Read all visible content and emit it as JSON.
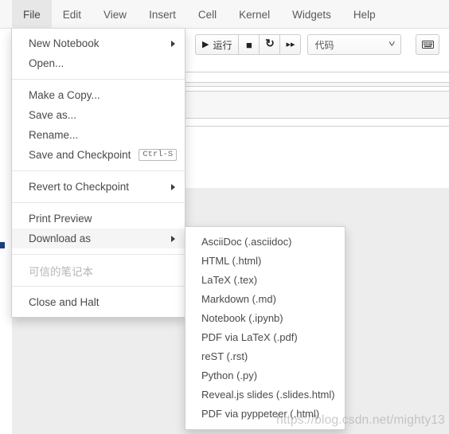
{
  "menubar": {
    "tabs": [
      {
        "label": "File",
        "active": true
      },
      {
        "label": "Edit",
        "active": false
      },
      {
        "label": "View",
        "active": false
      },
      {
        "label": "Insert",
        "active": false
      },
      {
        "label": "Cell",
        "active": false
      },
      {
        "label": "Kernel",
        "active": false
      },
      {
        "label": "Widgets",
        "active": false
      },
      {
        "label": "Help",
        "active": false
      }
    ]
  },
  "toolbar": {
    "run_label": "运行",
    "run_icon": "play-icon",
    "stop_icon": "stop-square-icon",
    "restart_icon": "restart-circle-arrow-icon",
    "fastforward_icon": "fast-forward-icon",
    "cell_type_value": "代码",
    "cell_type_caret_icon": "chevron-down-icon",
    "keyboard_icon": "keyboard-icon"
  },
  "file_menu": {
    "groups": [
      {
        "items": [
          {
            "label": "New Notebook",
            "submenu": true,
            "disabled": false,
            "hover": false,
            "shortcut": null
          },
          {
            "label": "Open...",
            "submenu": false,
            "disabled": false,
            "hover": false,
            "shortcut": null
          }
        ]
      },
      {
        "items": [
          {
            "label": "Make a Copy...",
            "submenu": false,
            "disabled": false,
            "hover": false,
            "shortcut": null
          },
          {
            "label": "Save as...",
            "submenu": false,
            "disabled": false,
            "hover": false,
            "shortcut": null
          },
          {
            "label": "Rename...",
            "submenu": false,
            "disabled": false,
            "hover": false,
            "shortcut": null
          },
          {
            "label": "Save and Checkpoint",
            "submenu": false,
            "disabled": false,
            "hover": false,
            "shortcut": "Ctrl-S"
          }
        ]
      },
      {
        "items": [
          {
            "label": "Revert to Checkpoint",
            "submenu": true,
            "disabled": false,
            "hover": false,
            "shortcut": null
          }
        ]
      },
      {
        "items": [
          {
            "label": "Print Preview",
            "submenu": false,
            "disabled": false,
            "hover": false,
            "shortcut": null
          },
          {
            "label": "Download as",
            "submenu": true,
            "disabled": false,
            "hover": true,
            "shortcut": null
          }
        ]
      },
      {
        "items": [
          {
            "label": "可信的笔记本",
            "submenu": false,
            "disabled": true,
            "hover": false,
            "shortcut": null
          }
        ]
      },
      {
        "items": [
          {
            "label": "Close and Halt",
            "submenu": false,
            "disabled": false,
            "hover": false,
            "shortcut": null
          }
        ]
      }
    ]
  },
  "download_submenu": {
    "items": [
      {
        "label": "AsciiDoc (.asciidoc)"
      },
      {
        "label": "HTML (.html)"
      },
      {
        "label": "LaTeX (.tex)"
      },
      {
        "label": "Markdown (.md)"
      },
      {
        "label": "Notebook (.ipynb)"
      },
      {
        "label": "PDF via LaTeX (.pdf)"
      },
      {
        "label": "reST (.rst)"
      },
      {
        "label": "Python (.py)"
      },
      {
        "label": "Reveal.js slides (.slides.html)"
      },
      {
        "label": "PDF via pyppeteer (.html)"
      }
    ]
  },
  "watermark": {
    "text": "https://blog.csdn.net/mighty13"
  },
  "colors": {
    "menubar_bg": "#f7f7f7",
    "active_tab_bg": "#e7e7e7",
    "menu_bg": "#ffffff",
    "hover_bg": "#f5f5f5",
    "text": "#4a4a4a",
    "disabled_text": "#b5b5b5",
    "border": "#cfcfcf"
  }
}
